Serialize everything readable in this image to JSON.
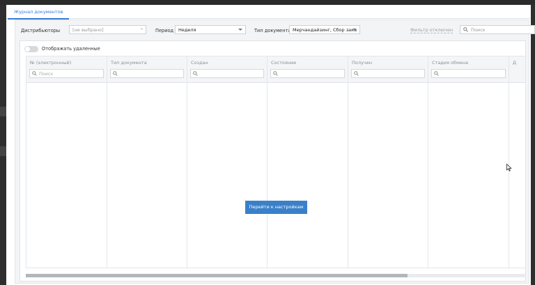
{
  "tab": {
    "label": "Журнал документов"
  },
  "filters": {
    "distributors_label": "Дистрибьюторы",
    "distributors_value": "[не выбрано]",
    "period_label": "Период",
    "period_value": "Неделя",
    "doctype_label": "Тип документа",
    "doctype_value": "Мерчандайзинг, Сбор зака",
    "filter_status": "Фильтр отключен",
    "search_placeholder": "Поиск"
  },
  "toggle": {
    "label": "Отображать удаленные",
    "on": false
  },
  "columns": [
    {
      "title": "№ (электронный)",
      "search_placeholder": "Поиск"
    },
    {
      "title": "Тип документа",
      "search_placeholder": ""
    },
    {
      "title": "Создан",
      "search_placeholder": ""
    },
    {
      "title": "Состояние",
      "search_placeholder": ""
    },
    {
      "title": "Получен",
      "search_placeholder": ""
    },
    {
      "title": "Стадия обмена",
      "search_placeholder": ""
    },
    {
      "title": "Д",
      "search_placeholder": ""
    }
  ],
  "actions": {
    "goto_settings": "Перейти к настройкам"
  },
  "colors": {
    "accent": "#3a7bd5",
    "button": "#3a80c9"
  }
}
